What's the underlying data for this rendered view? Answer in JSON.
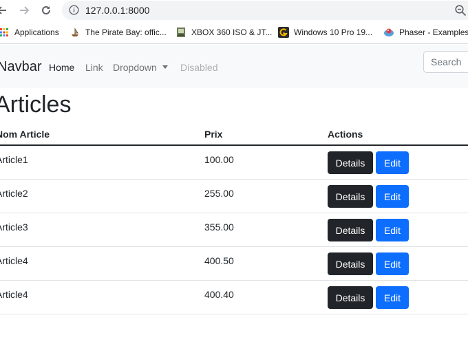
{
  "browser": {
    "url": "127.0.0.1:8000",
    "bookmarks": [
      {
        "label": "Applications",
        "icon": "apps-grid-icon"
      },
      {
        "label": "The Pirate Bay: offic...",
        "icon": "pirate-ship-icon"
      },
      {
        "label": "XBOX 360 ISO & JT...",
        "icon": "xbox-site-icon"
      },
      {
        "label": "Windows 10 Pro 19...",
        "icon": "g-site-icon"
      },
      {
        "label": "Phaser - Examples",
        "icon": "phaser-icon"
      }
    ]
  },
  "navbar": {
    "brand": "Navbar",
    "links": [
      {
        "label": "Home",
        "state": "active"
      },
      {
        "label": "Link",
        "state": "normal"
      },
      {
        "label": "Dropdown",
        "state": "dropdown"
      },
      {
        "label": "Disabled",
        "state": "disabled"
      }
    ],
    "search_placeholder": "Search"
  },
  "main": {
    "title": "Articles",
    "columns": [
      "Nom Article",
      "Prix",
      "Actions"
    ],
    "rows": [
      {
        "name": "Article1",
        "price": "100.00"
      },
      {
        "name": "Article2",
        "price": "255.00"
      },
      {
        "name": "Article3",
        "price": "355.00"
      },
      {
        "name": "Article4",
        "price": "400.50"
      },
      {
        "name": "Article4",
        "price": "400.40"
      }
    ],
    "details_label": "Details",
    "edit_label": "Edit"
  },
  "colors": {
    "primary": "#0d6efd",
    "dark": "#212529",
    "navbar_bg": "#f8f9fa"
  }
}
